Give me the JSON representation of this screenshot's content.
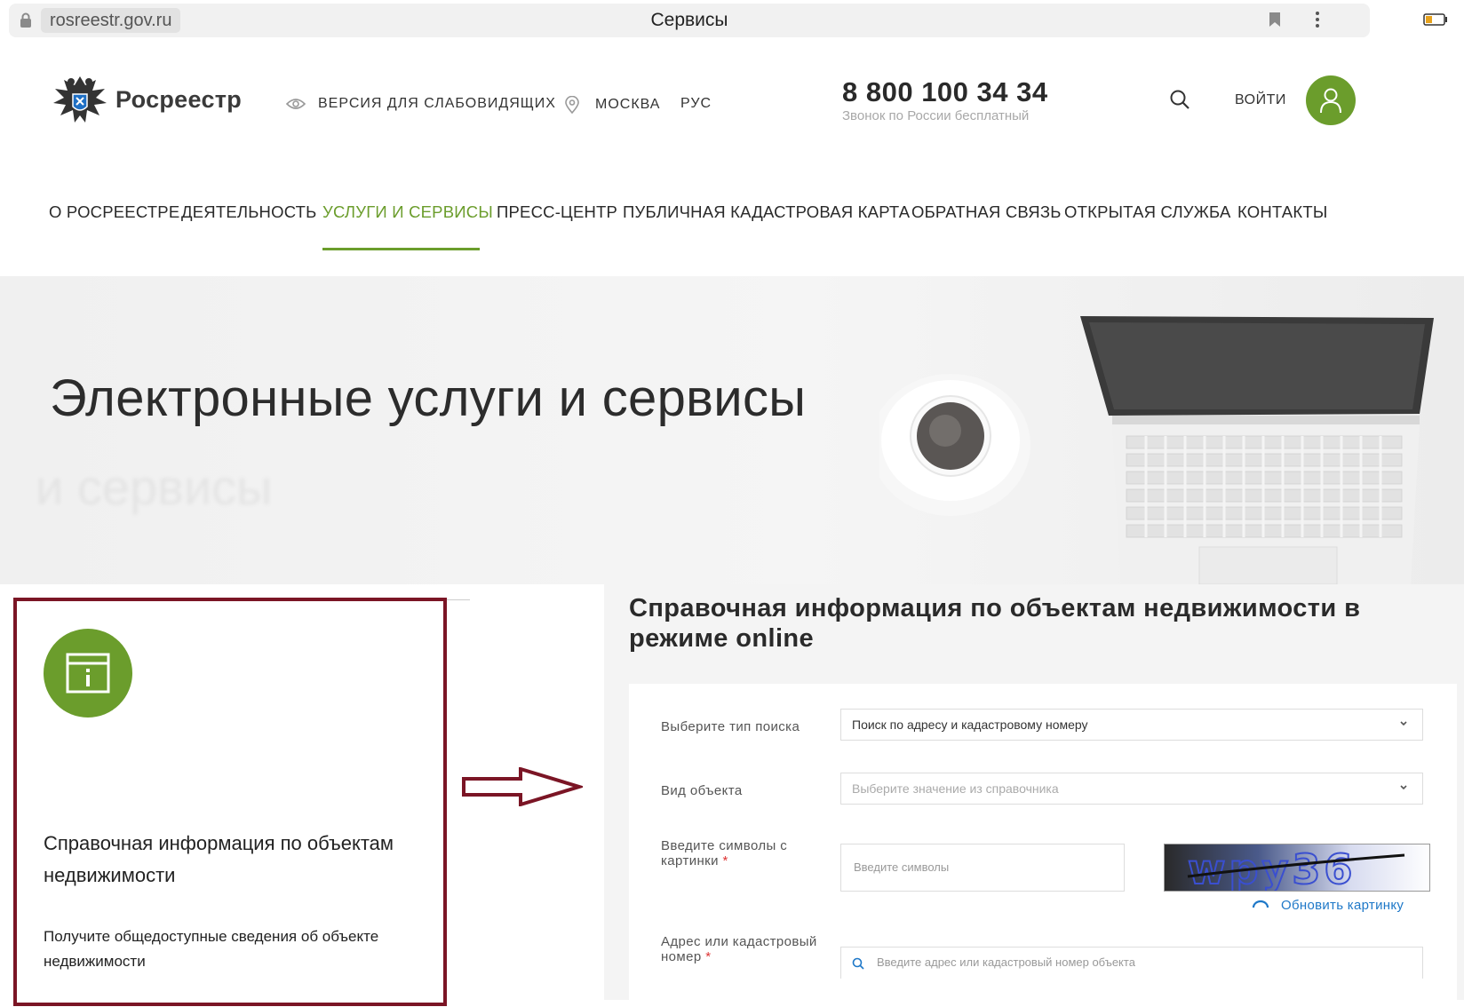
{
  "browser": {
    "url": "rosreestr.gov.ru",
    "tab_title": "Сервисы",
    "icons": [
      "lock-icon",
      "bookmark-icon",
      "kebab-menu-icon",
      "battery-icon"
    ]
  },
  "header": {
    "logo_text": "Росреестр",
    "accessibility_label": "ВЕРСИЯ ДЛЯ СЛАБОВИДЯЩИХ",
    "city_label": "МОСКВА",
    "lang_label": "РУС",
    "phone": "8 800 100 34 34",
    "phone_note": "Звонок по России бесплатный",
    "login_label": "ВОЙТИ",
    "icons": [
      "emblem-icon",
      "eye-icon",
      "map-pin-icon",
      "search-icon",
      "user-icon"
    ]
  },
  "nav": {
    "items": [
      {
        "label": "О РОСРЕЕСТРЕ"
      },
      {
        "label": "ДЕЯТЕЛЬНОСТЬ"
      },
      {
        "label": "УСЛУГИ И СЕРВИСЫ",
        "active": true
      },
      {
        "label": "ПРЕСС-ЦЕНТР"
      },
      {
        "label": "ПУБЛИЧНАЯ КАДАСТРОВАЯ КАРТА"
      },
      {
        "label": "ОБРАТНАЯ СВЯЗЬ"
      },
      {
        "label": "ОТКРЫТАЯ СЛУЖБА"
      },
      {
        "label": "КОНТАКТЫ"
      }
    ]
  },
  "hero": {
    "title": "Электронные услуги и сервисы",
    "ghost_text": "и сервисы"
  },
  "card": {
    "title": "Справочная информация по объектам недвижимости",
    "description": "Получите общедоступные сведения об объекте недвижимости",
    "icon": "info-window-icon"
  },
  "panel": {
    "title": "Справочная информация по объектам недвижимости в режиме online",
    "search_type_label": "Выберите тип поиска",
    "search_type_value": "Поиск по адресу и кадастровому номеру",
    "object_type_label": "Вид объекта",
    "object_type_placeholder": "Выберите значение из справочника",
    "captcha_label": "Введите символы с картинки",
    "captcha_placeholder": "Введите символы",
    "captcha_text": "wpy36",
    "refresh_label": "Обновить картинку",
    "address_label": "Адрес или кадастровый номер",
    "address_placeholder": "Введите адрес или кадастровый номер объекта",
    "required_mark": "*"
  },
  "colors": {
    "brand_green": "#6b9d2c",
    "highlight_border": "#7b1525",
    "link_blue": "#1e78c8"
  }
}
